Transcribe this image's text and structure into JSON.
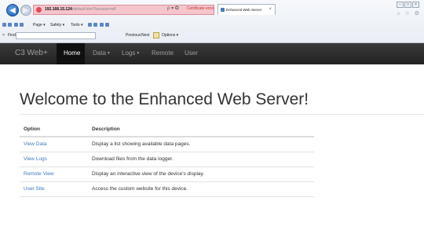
{
  "browser": {
    "address_ip": "192.168.15.124",
    "address_path": "/default.htm?/session=aff",
    "address_tools": "ρ ▾ ✪",
    "cert_error": "Certificate error",
    "tab_title": "Enhanced Web Server",
    "tab_close": "×",
    "win_controls": [
      "–",
      "□",
      "×"
    ],
    "right_icons": "⌂ ☆ ⚙",
    "commands": [
      "Page ▾",
      "Safety ▾",
      "Tools ▾"
    ],
    "find": {
      "close": "×",
      "label": "Find:",
      "value": "",
      "previous": "Previous",
      "next": "Next",
      "options": "Options ▾"
    }
  },
  "navbar": {
    "brand": "C3 Web+",
    "items": [
      {
        "label": "Home",
        "active": true
      },
      {
        "label": "Data",
        "caret": true
      },
      {
        "label": "Logs",
        "caret": true
      },
      {
        "label": "Remote"
      },
      {
        "label": "User"
      }
    ]
  },
  "main": {
    "headline": "Welcome to the Enhanced Web Server!",
    "table": {
      "headers": [
        "Option",
        "Description"
      ],
      "rows": [
        {
          "option": "View Data",
          "description": "Display a list showing available data pages."
        },
        {
          "option": "View Logs",
          "description": "Download files from the data logger."
        },
        {
          "option": "Remote View",
          "description": "Display an interactive view of the device's display."
        },
        {
          "option": "User Site",
          "description": "Access the custom website for this device."
        }
      ]
    }
  }
}
